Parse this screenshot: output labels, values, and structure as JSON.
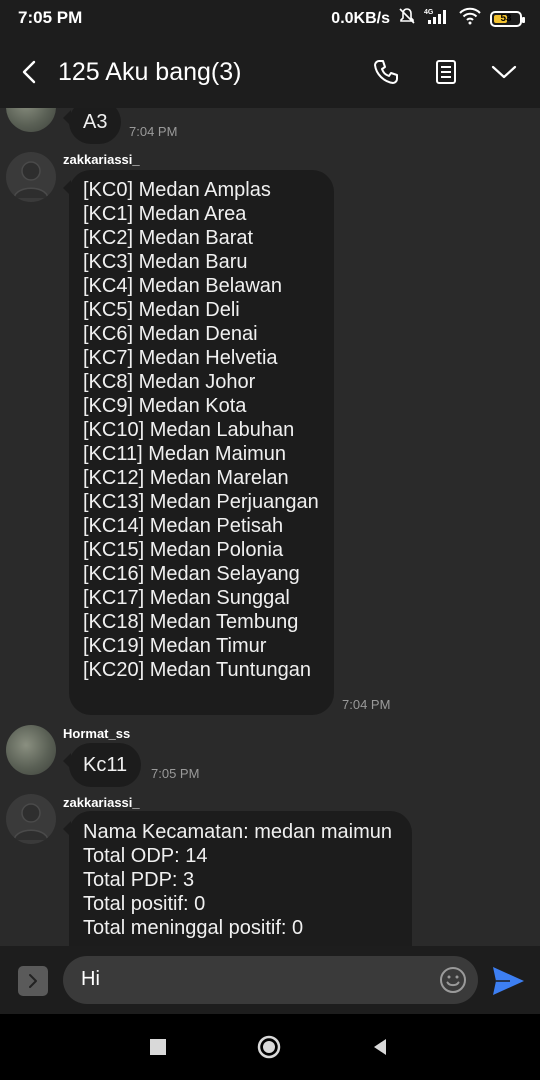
{
  "status": {
    "time": "7:05 PM",
    "speed": "0.0KB/s",
    "network_label": "4G",
    "battery": "53",
    "battery_level": 0.53
  },
  "header": {
    "title": "125 Aku bang(3)"
  },
  "messages": {
    "m1": {
      "text": "A3",
      "time": "7:04 PM"
    },
    "m2": {
      "sender": "zakkariassi_",
      "lines": [
        "[KC0] Medan Amplas",
        "[KC1] Medan Area",
        "[KC2] Medan Barat",
        "[KC3] Medan Baru",
        "[KC4] Medan Belawan",
        "[KC5] Medan Deli",
        "[KC6] Medan Denai",
        "[KC7] Medan Helvetia",
        "[KC8] Medan Johor",
        "[KC9] Medan Kota",
        "[KC10] Medan Labuhan",
        "[KC11] Medan Maimun",
        "[KC12] Medan Marelan",
        "[KC13] Medan Perjuangan",
        "[KC14] Medan Petisah",
        "[KC15] Medan Polonia",
        "[KC16] Medan Selayang",
        "[KC17] Medan Sunggal",
        "[KC18] Medan Tembung",
        "[KC19] Medan Timur",
        "[KC20] Medan Tuntungan"
      ],
      "time": "7:04 PM"
    },
    "m3": {
      "sender": "Hormat_ss",
      "text": "Kc11",
      "time": "7:05 PM"
    },
    "m4": {
      "sender": "zakkariassi_",
      "lines": [
        "Nama Kecamatan: medan maimun",
        "Total ODP: 14",
        "Total PDP: 3",
        "Total positif: 0",
        "Total meninggal positif: 0"
      ]
    }
  },
  "input": {
    "value": "Hi"
  },
  "colors": {
    "background": "#2a2a2a",
    "bubble": "#1c1c1c",
    "send_accent": "#3d7ff2",
    "battery": "#f2c230"
  },
  "icons": {
    "back": "back-arrow-icon",
    "call": "phone-icon",
    "details": "document-icon",
    "menu": "chevron-down-icon",
    "expand": "chevron-right-icon",
    "emoji": "smiley-icon",
    "send": "send-icon"
  }
}
